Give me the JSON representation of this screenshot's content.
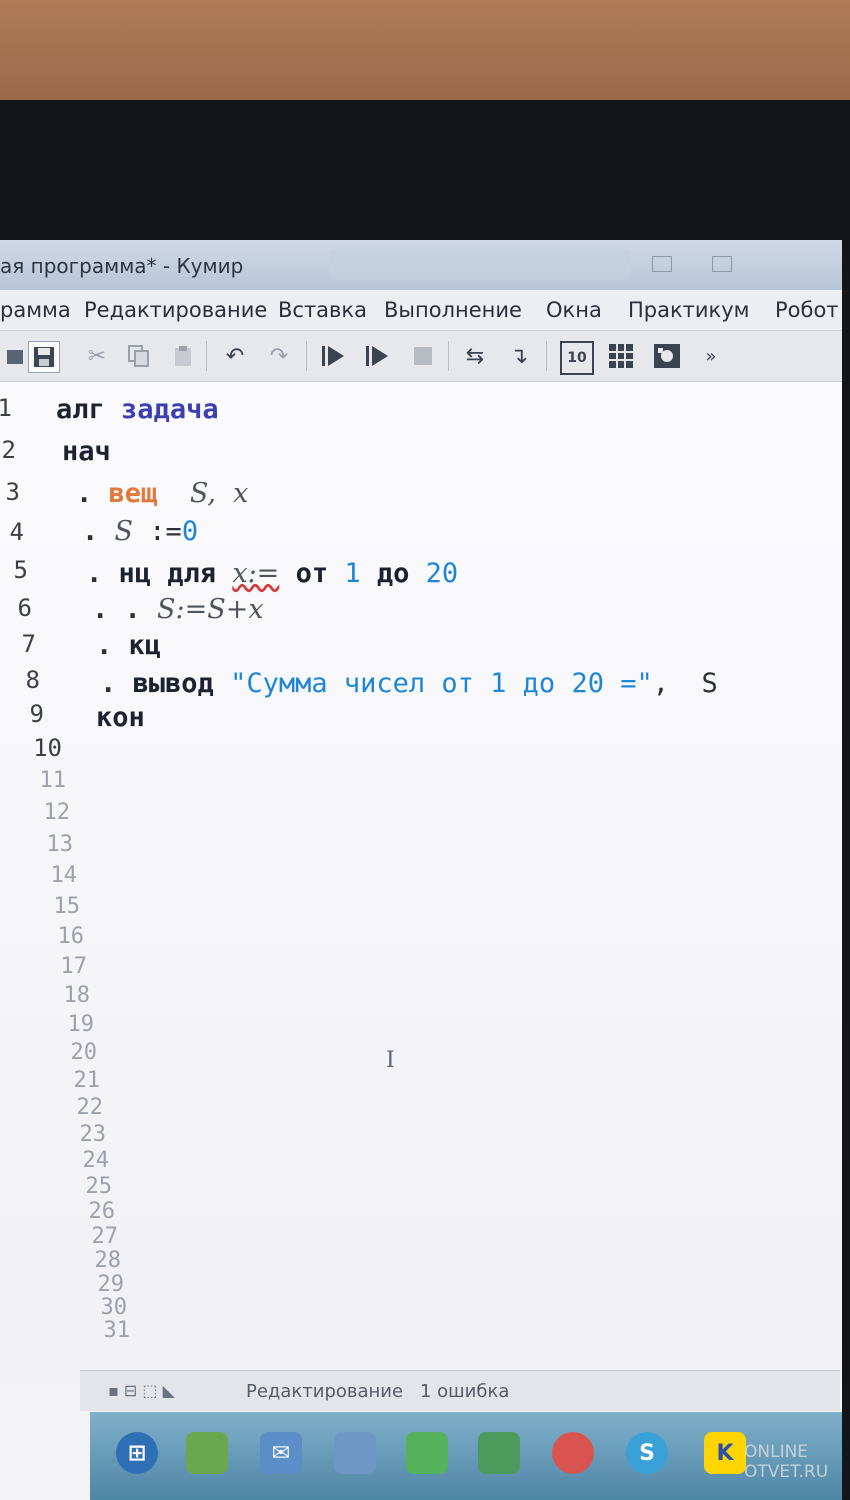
{
  "window": {
    "title": "ая программа* - Кумир"
  },
  "menu": {
    "items": [
      "рамма",
      "Редактирование",
      "Вставка",
      "Выполнение",
      "Окна",
      "Практикум",
      "Робот"
    ]
  },
  "editor": {
    "line_numbers": [
      "1",
      "2",
      "3",
      "4",
      "5",
      "6",
      "7",
      "8",
      "9",
      "10",
      "11",
      "12",
      "13",
      "14",
      "15",
      "16",
      "17",
      "18",
      "19",
      "20",
      "21",
      "22",
      "23",
      "24",
      "25",
      "26",
      "27",
      "28",
      "29",
      "30",
      "31"
    ],
    "code": {
      "l1_kw": "алг",
      "l1_name": "задача",
      "l2_kw": "нач",
      "l3_dot": ".",
      "l3_kw": "вещ",
      "l3_vars": "S,  x",
      "l4_dot": ".",
      "l4_var": "S",
      "l4_op": " :=",
      "l4_num": "0",
      "l5_dot": ".",
      "l5_kw": "нц для",
      "l5_var": "x:=",
      "l5_ot": "от",
      "l5_from": "1",
      "l5_do": "до",
      "l5_to": "20",
      "l6_dots": ". .",
      "l6_expr": "S:=S+x",
      "l7_dot": ".",
      "l7_kw": "кц",
      "l8_dot": ".",
      "l8_kw": "вывод",
      "l8_str": "\"Сумма чисел от 1 до 20 =\"",
      "l8_tail": ",  S",
      "l9_kw": "кон"
    }
  },
  "status": {
    "mode": "Редактирование",
    "errors": "1 ошибка"
  },
  "watermark": {
    "line1": "ONLINE",
    "line2": "OTVET.RU"
  },
  "taskbar_badge": "K"
}
